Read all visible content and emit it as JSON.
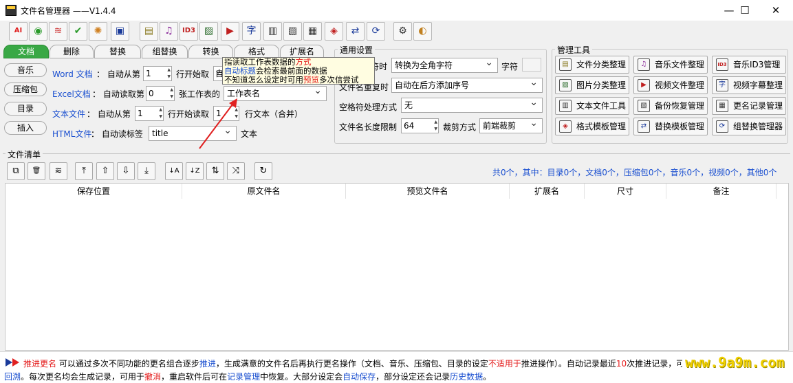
{
  "window": {
    "title": "文件名管理器  ——V1.4.4",
    "minimize": "—",
    "maximize": "☐",
    "close": "✕"
  },
  "toolbar": [
    {
      "name": "ai-icon",
      "glyph": "AI",
      "color": "#e02020"
    },
    {
      "name": "eye-icon",
      "glyph": "◉",
      "color": "#2a9a2a"
    },
    {
      "name": "wave-icon",
      "glyph": "≋",
      "color": "#d04040"
    },
    {
      "name": "check-icon",
      "glyph": "✔",
      "color": "#2a9a2a"
    },
    {
      "name": "sparkle-icon",
      "glyph": "✺",
      "color": "#d08020"
    },
    {
      "name": "save-icon",
      "glyph": "▣",
      "color": "#1a3a9a"
    },
    {
      "name": "archive-icon",
      "glyph": "▤",
      "color": "#8a7a20"
    },
    {
      "name": "music-file-icon",
      "glyph": "♫",
      "color": "#8a2a9a"
    },
    {
      "name": "id3-icon",
      "glyph": "ID3",
      "color": "#c02020"
    },
    {
      "name": "image-file-icon",
      "glyph": "▨",
      "color": "#2a6a2a"
    },
    {
      "name": "video-file-icon",
      "glyph": "▶",
      "color": "#c02020"
    },
    {
      "name": "subtitle-file-icon",
      "glyph": "字",
      "color": "#1a3a9a"
    },
    {
      "name": "text-file-icon",
      "glyph": "▥",
      "color": "#333"
    },
    {
      "name": "backup-icon",
      "glyph": "▧",
      "color": "#333"
    },
    {
      "name": "record-icon",
      "glyph": "▦",
      "color": "#333"
    },
    {
      "name": "template-icon",
      "glyph": "◈",
      "color": "#c02020"
    },
    {
      "name": "replace-template-icon",
      "glyph": "⇄",
      "color": "#1a3a9a"
    },
    {
      "name": "group-replace-icon",
      "glyph": "⟳",
      "color": "#1a3a9a"
    },
    {
      "name": "settings-icon",
      "glyph": "⚙",
      "color": "#333"
    },
    {
      "name": "about-icon",
      "glyph": "◐",
      "color": "#c08020"
    }
  ],
  "tabs": [
    "文档",
    "删除",
    "替换",
    "组替换",
    "转换",
    "格式",
    "扩展名"
  ],
  "side_tabs": [
    "音乐",
    "压缩包",
    "目录",
    "插入"
  ],
  "doc": {
    "word_label": "Word 文档",
    "word_from": "：  自动从第",
    "word_value": "1",
    "word_row": "行开始取",
    "word_combo": "自",
    "excel_label": "Excel文档",
    "excel_from": "：  自动读取第",
    "excel_value": "0",
    "excel_sheet": "张工作表的",
    "excel_combo": "工作表名",
    "text_label": "文本文件",
    "text_from": "：  自动从第",
    "text_value": "1",
    "text_row": "行开始读取",
    "text_value2": "1",
    "text_suffix": "行文本（合并）",
    "html_label": "HTML文件",
    "html_from": "：  自动读标签",
    "html_combo": "title",
    "html_suffix": "文本"
  },
  "tooltip": {
    "l1a": "指读取工作表数据的",
    "l1b": "方式",
    "l2a": "自动标题",
    "l2b": "会检索最前面的数据",
    "l3a": "不知道怎么设定时可用",
    "l3b": "预览",
    "l3c": "多次信尝试"
  },
  "general": {
    "title": "通用设置",
    "row1_label": "符时",
    "row1_combo": "转换为全角字符",
    "row1_suffix": "字符",
    "row2_label": "文件名重复时",
    "row2_combo": "自动在后方添加序号",
    "row3_label": "空格符处理方式",
    "row3_combo": "无",
    "row4_label": "文件名长度限制",
    "row4_value": "64",
    "row4_cut": "裁剪方式",
    "row4_combo": "前端裁剪"
  },
  "tools": {
    "title": "管理工具",
    "buttons": [
      {
        "label": "文件分类整理",
        "glyph": "▤",
        "color": "#8a7a20"
      },
      {
        "label": "音乐文件整理",
        "glyph": "♫",
        "color": "#8a2a9a"
      },
      {
        "label": "音乐ID3管理",
        "glyph": "ID3",
        "color": "#c02020"
      },
      {
        "label": "图片分类整理",
        "glyph": "▨",
        "color": "#2a6a2a"
      },
      {
        "label": "视频文件整理",
        "glyph": "▶",
        "color": "#c02020"
      },
      {
        "label": "视频字幕整理",
        "glyph": "字",
        "color": "#1a3a9a"
      },
      {
        "label": "文本文件工具",
        "glyph": "▥",
        "color": "#333"
      },
      {
        "label": "备份恢复管理",
        "glyph": "▧",
        "color": "#333"
      },
      {
        "label": "更名记录管理",
        "glyph": "▦",
        "color": "#333"
      },
      {
        "label": "格式模板管理",
        "glyph": "◈",
        "color": "#c02020"
      },
      {
        "label": "替换模板管理",
        "glyph": "⇄",
        "color": "#1a3a9a"
      },
      {
        "label": "组替换管理器",
        "glyph": "⟳",
        "color": "#1a3a9a"
      }
    ]
  },
  "filelist": {
    "title": "文件清单",
    "summary": "共0个，其中：目录0个，文档0个，压缩包0个，音乐0个，视频0个，其他0个",
    "buttons": [
      {
        "name": "add-files-icon",
        "glyph": "⧉"
      },
      {
        "name": "delete-icon",
        "glyph": "🗑"
      },
      {
        "name": "clear-icon",
        "glyph": "≋"
      },
      {
        "name": "move-top-icon",
        "glyph": "⤒"
      },
      {
        "name": "move-up-icon",
        "glyph": "⇧"
      },
      {
        "name": "move-down-icon",
        "glyph": "⇩"
      },
      {
        "name": "move-bottom-icon",
        "glyph": "⤓"
      },
      {
        "name": "sort-asc-icon",
        "glyph": "↓A"
      },
      {
        "name": "sort-desc-icon",
        "glyph": "↓Z"
      },
      {
        "name": "reverse-icon",
        "glyph": "⇅"
      },
      {
        "name": "shuffle-icon",
        "glyph": "⤨"
      },
      {
        "name": "refresh-icon",
        "glyph": "↻"
      }
    ],
    "columns": [
      "保存位置",
      "原文件名",
      "预览文件名",
      "扩展名",
      "尺寸",
      "备注"
    ]
  },
  "footer": {
    "line1": [
      {
        "t": "推进更名",
        "c": "red"
      },
      {
        "t": "  可以通过多次不同功能的更名组合逐步",
        "c": ""
      },
      {
        "t": "推进",
        "c": "blue"
      },
      {
        "t": "，生成满意的文件名后再执行更名操作（文档、音乐、压缩包、目录的设定",
        "c": ""
      },
      {
        "t": "不适用于",
        "c": "red"
      },
      {
        "t": "推进操作）。自动记录最近",
        "c": ""
      },
      {
        "t": "10",
        "c": "red"
      },
      {
        "t": "次推进记录，可",
        "c": ""
      }
    ],
    "line2": [
      {
        "t": "回溯",
        "c": "blue"
      },
      {
        "t": "。每次更名均会生成记录，可用于",
        "c": ""
      },
      {
        "t": "撤消",
        "c": "red"
      },
      {
        "t": "，重启软件后可在",
        "c": ""
      },
      {
        "t": "记录管理",
        "c": "blue"
      },
      {
        "t": "中恢复。大部分设定会",
        "c": ""
      },
      {
        "t": "自动保存",
        "c": "blue"
      },
      {
        "t": "，部分设定还会记录",
        "c": ""
      },
      {
        "t": "历史数据",
        "c": "blue"
      },
      {
        "t": "。",
        "c": ""
      }
    ],
    "watermark": "www.9a9m.com"
  },
  "colors": {
    "accent_green": "#39a845",
    "link_blue": "#1a4fd0",
    "warn_red": "#e41b1b",
    "watermark": "#f0d000"
  }
}
